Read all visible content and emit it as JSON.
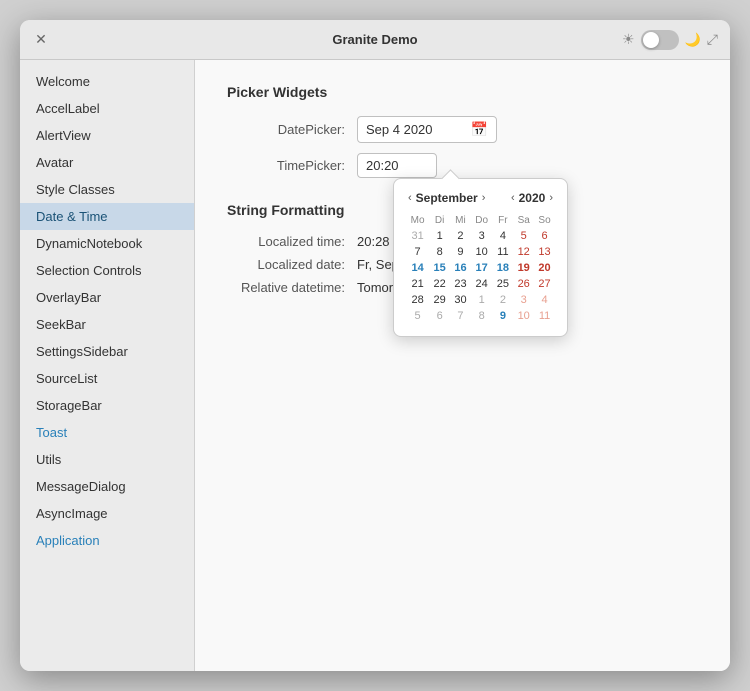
{
  "window": {
    "title": "Granite Demo",
    "close_label": "✕"
  },
  "sidebar": {
    "items": [
      {
        "label": "Welcome",
        "active": false,
        "blue": false
      },
      {
        "label": "AccelLabel",
        "active": false,
        "blue": false
      },
      {
        "label": "AlertView",
        "active": false,
        "blue": false
      },
      {
        "label": "Avatar",
        "active": false,
        "blue": false
      },
      {
        "label": "Style Classes",
        "active": false,
        "blue": false
      },
      {
        "label": "Date & Time",
        "active": true,
        "blue": false
      },
      {
        "label": "DynamicNotebook",
        "active": false,
        "blue": false
      },
      {
        "label": "Selection Controls",
        "active": false,
        "blue": false
      },
      {
        "label": "OverlayBar",
        "active": false,
        "blue": false
      },
      {
        "label": "SeekBar",
        "active": false,
        "blue": false
      },
      {
        "label": "SettingsSidebar",
        "active": false,
        "blue": false
      },
      {
        "label": "SourceList",
        "active": false,
        "blue": false
      },
      {
        "label": "StorageBar",
        "active": false,
        "blue": false
      },
      {
        "label": "Toast",
        "active": false,
        "blue": true
      },
      {
        "label": "Utils",
        "active": false,
        "blue": false
      },
      {
        "label": "MessageDialog",
        "active": false,
        "blue": false
      },
      {
        "label": "AsyncImage",
        "active": false,
        "blue": false
      },
      {
        "label": "Application",
        "active": false,
        "blue": true
      }
    ]
  },
  "main": {
    "picker_section_title": "Picker Widgets",
    "datepicker_label": "DatePicker:",
    "datepicker_value": "Sep  4 2020",
    "timepicker_label": "TimePicker:",
    "timepicker_value": "20:20",
    "string_section_title": "String Formatting",
    "localized_time_label": "Localized time:",
    "localized_time_value": "20:28",
    "localized_date_label": "Localized date:",
    "localized_date_value": "Fr, Sep 4, 2",
    "relative_datetime_label": "Relative datetime:",
    "relative_datetime_value": "Tomorrow"
  },
  "calendar": {
    "month_prev_arrow": "‹",
    "month": "September",
    "month_next_arrow": "›",
    "year_prev_arrow": "‹",
    "year": "2020",
    "year_next_arrow": "›",
    "day_headers": [
      "Mo",
      "Di",
      "Mi",
      "Do",
      "Fr",
      "Sa",
      "So"
    ],
    "weeks": [
      [
        {
          "day": "31",
          "other": true,
          "selected": false,
          "today": false,
          "weekend": false
        },
        {
          "day": "1",
          "other": false,
          "selected": false,
          "today": false,
          "weekend": false
        },
        {
          "day": "2",
          "other": false,
          "selected": false,
          "today": false,
          "weekend": false
        },
        {
          "day": "3",
          "other": false,
          "selected": false,
          "today": false,
          "weekend": false
        },
        {
          "day": "4",
          "other": false,
          "selected": false,
          "today": false,
          "weekend": false
        },
        {
          "day": "5",
          "other": false,
          "selected": false,
          "today": false,
          "weekend": true
        },
        {
          "day": "6",
          "other": false,
          "selected": false,
          "today": false,
          "weekend": true
        }
      ],
      [
        {
          "day": "7",
          "other": false,
          "selected": false,
          "today": false,
          "weekend": false
        },
        {
          "day": "8",
          "other": false,
          "selected": false,
          "today": false,
          "weekend": false
        },
        {
          "day": "9",
          "other": false,
          "selected": false,
          "today": false,
          "weekend": false
        },
        {
          "day": "10",
          "other": false,
          "selected": false,
          "today": false,
          "weekend": false
        },
        {
          "day": "11",
          "other": false,
          "selected": false,
          "today": false,
          "weekend": false
        },
        {
          "day": "12",
          "other": false,
          "selected": false,
          "today": false,
          "weekend": true
        },
        {
          "day": "13",
          "other": false,
          "selected": false,
          "today": false,
          "weekend": true
        }
      ],
      [
        {
          "day": "14",
          "other": false,
          "selected": false,
          "today": true,
          "weekend": false
        },
        {
          "day": "15",
          "other": false,
          "selected": false,
          "today": true,
          "weekend": false
        },
        {
          "day": "16",
          "other": false,
          "selected": false,
          "today": true,
          "weekend": false
        },
        {
          "day": "17",
          "other": false,
          "selected": false,
          "today": true,
          "weekend": false
        },
        {
          "day": "18",
          "other": false,
          "selected": false,
          "today": true,
          "weekend": false
        },
        {
          "day": "19",
          "other": false,
          "selected": false,
          "today": true,
          "weekend": true
        },
        {
          "day": "20",
          "other": false,
          "selected": false,
          "today": true,
          "weekend": true
        }
      ],
      [
        {
          "day": "21",
          "other": false,
          "selected": false,
          "today": false,
          "weekend": false
        },
        {
          "day": "22",
          "other": false,
          "selected": false,
          "today": false,
          "weekend": false
        },
        {
          "day": "23",
          "other": false,
          "selected": false,
          "today": false,
          "weekend": false
        },
        {
          "day": "24",
          "other": false,
          "selected": false,
          "today": false,
          "weekend": false
        },
        {
          "day": "25",
          "other": false,
          "selected": false,
          "today": false,
          "weekend": false
        },
        {
          "day": "26",
          "other": false,
          "selected": false,
          "today": false,
          "weekend": true
        },
        {
          "day": "27",
          "other": false,
          "selected": false,
          "today": false,
          "weekend": true
        }
      ],
      [
        {
          "day": "28",
          "other": false,
          "selected": false,
          "today": false,
          "weekend": false
        },
        {
          "day": "29",
          "other": false,
          "selected": false,
          "today": false,
          "weekend": false
        },
        {
          "day": "30",
          "other": false,
          "selected": false,
          "today": false,
          "weekend": false
        },
        {
          "day": "1",
          "other": true,
          "selected": false,
          "today": false,
          "weekend": false
        },
        {
          "day": "2",
          "other": true,
          "selected": false,
          "today": false,
          "weekend": false
        },
        {
          "day": "3",
          "other": true,
          "selected": false,
          "today": false,
          "weekend": true
        },
        {
          "day": "4",
          "other": true,
          "selected": false,
          "today": false,
          "weekend": true
        }
      ],
      [
        {
          "day": "5",
          "other": true,
          "selected": false,
          "today": false,
          "weekend": false
        },
        {
          "day": "6",
          "other": true,
          "selected": false,
          "today": false,
          "weekend": false
        },
        {
          "day": "7",
          "other": true,
          "selected": false,
          "today": false,
          "weekend": false
        },
        {
          "day": "8",
          "other": true,
          "selected": false,
          "today": false,
          "weekend": false
        },
        {
          "day": "9",
          "other": true,
          "selected": false,
          "today": true,
          "weekend": false
        },
        {
          "day": "10",
          "other": true,
          "selected": false,
          "today": false,
          "weekend": true
        },
        {
          "day": "11",
          "other": true,
          "selected": false,
          "today": false,
          "weekend": true
        }
      ]
    ]
  }
}
